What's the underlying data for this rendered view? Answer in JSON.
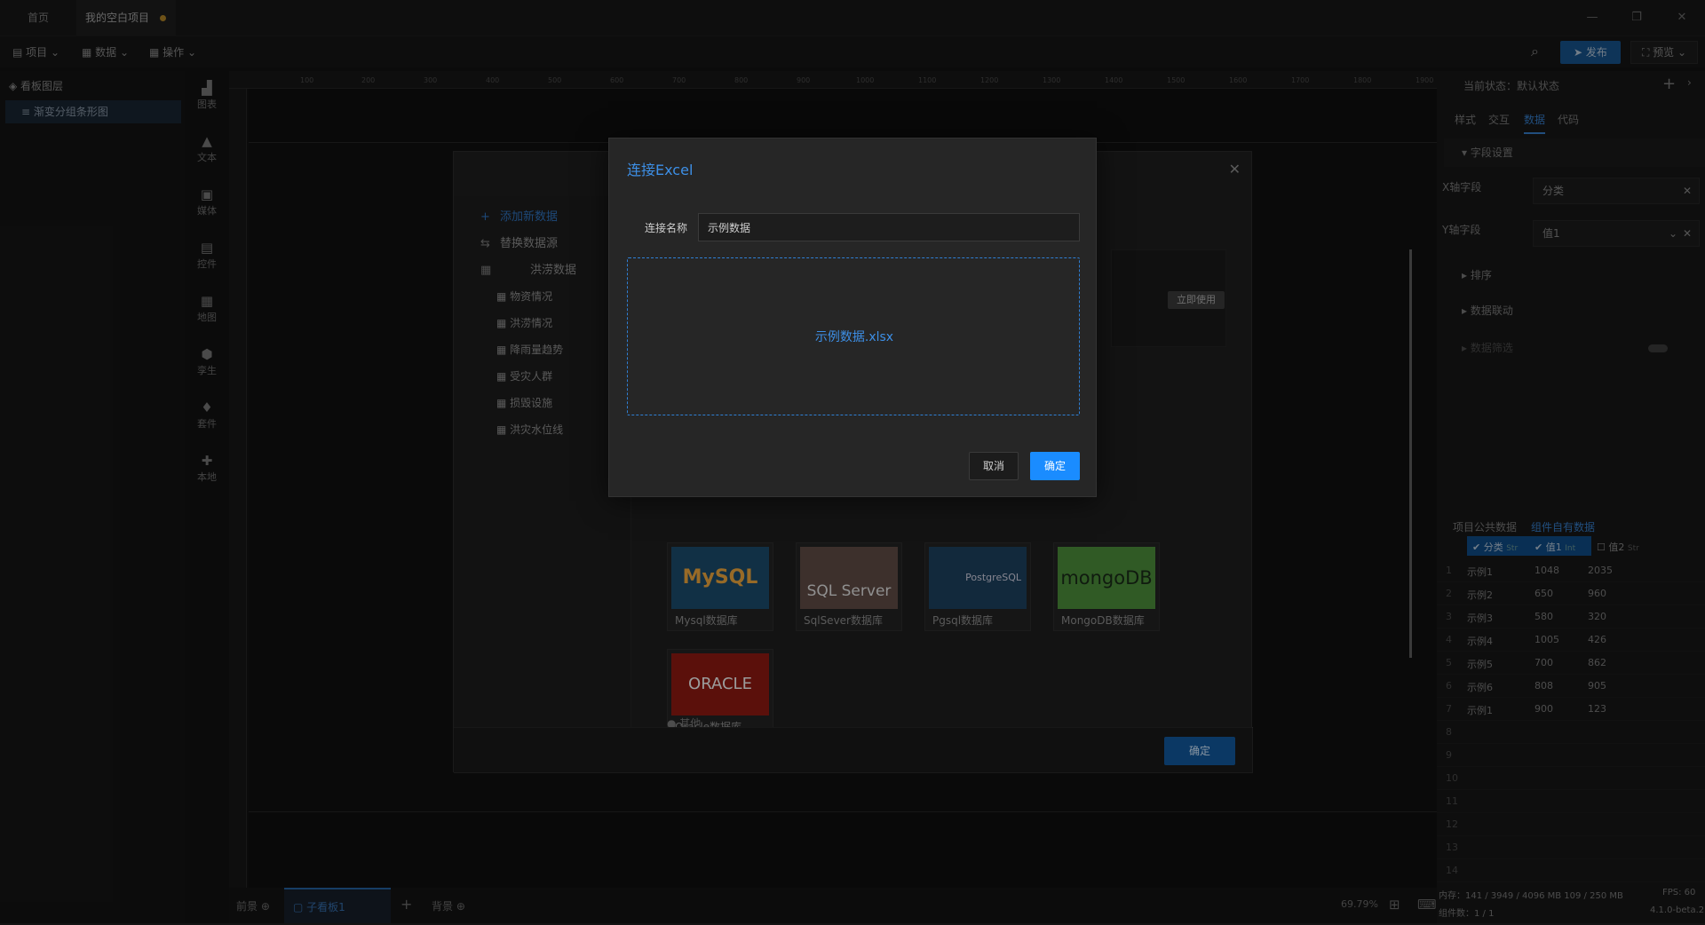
{
  "tabs": {
    "home": "首页",
    "project": "我的空白项目"
  },
  "toolbar": {
    "project": "项目",
    "data": "数据",
    "operate": "操作",
    "publish": "发布",
    "preview": "预览"
  },
  "layers": {
    "title": "看板图层",
    "item": "渐变分组条形图"
  },
  "iconbar": [
    "图表",
    "文本",
    "媒体",
    "控件",
    "地图",
    "孪生",
    "套件",
    "本地"
  ],
  "ruler": [
    "100",
    "200",
    "300",
    "400",
    "500",
    "600",
    "700",
    "800",
    "900",
    "1000",
    "1100",
    "1200",
    "1300",
    "1400",
    "1500",
    "1600",
    "1700",
    "1800",
    "1900"
  ],
  "bottom": {
    "front": "前景",
    "child": "子看板1",
    "back": "背景",
    "zoom": "69.79%"
  },
  "right": {
    "state_label": "当前状态：默认状态",
    "tabs": [
      "样式",
      "交互",
      "数据",
      "代码"
    ],
    "field_settings": "字段设置",
    "x_label": "X轴字段",
    "x_value": "分类",
    "y_label": "Y轴字段",
    "y_value": "值1",
    "sort": "排序",
    "link": "数据联动",
    "filter": "数据筛选",
    "data_tabs": [
      "项目公共数据",
      "组件自有数据"
    ],
    "columns": [
      "分类",
      "值1",
      "值2"
    ],
    "col_types": [
      "Str",
      "Int",
      "Str"
    ],
    "rows": [
      [
        "1",
        "示例1",
        "1048",
        "2035"
      ],
      [
        "2",
        "示例2",
        "650",
        "960"
      ],
      [
        "3",
        "示例3",
        "580",
        "320"
      ],
      [
        "4",
        "示例4",
        "1005",
        "426"
      ],
      [
        "5",
        "示例5",
        "700",
        "862"
      ],
      [
        "6",
        "示例6",
        "808",
        "905"
      ],
      [
        "7",
        "示例1",
        "900",
        "123"
      ],
      [
        "8",
        "",
        "",
        ""
      ],
      [
        "9",
        "",
        "",
        ""
      ],
      [
        "10",
        "",
        "",
        ""
      ],
      [
        "11",
        "",
        "",
        ""
      ],
      [
        "12",
        "",
        "",
        ""
      ],
      [
        "13",
        "",
        "",
        ""
      ],
      [
        "14",
        "",
        "",
        ""
      ]
    ],
    "memory": "内存：141 / 3949 / 4096 MB  109 / 250 MB",
    "fps": "FPS:  60",
    "components": "组件数：1 / 1",
    "version": "4.1.0-beta.2"
  },
  "datasource": {
    "nav_add": "添加新数据",
    "nav_replace": "替换数据源",
    "group": "洪涝数据",
    "items": [
      "物资情况",
      "洪涝情况",
      "降雨量趋势",
      "受灾人群",
      "损毁设施",
      "洪灾水位线"
    ],
    "use_now": "立即使用",
    "dbs": [
      "Mysql数据库",
      "SqlSever数据库",
      "Pgsql数据库",
      "MongoDB数据库",
      "Oracle数据库"
    ],
    "db_logos": [
      "MySQL",
      "SQL Server",
      "PostgreSQL",
      "mongoDB",
      "ORACLE"
    ],
    "other": "其他",
    "ok": "确定"
  },
  "excel": {
    "title": "连接Excel",
    "name_label": "连接名称",
    "name_value": "示例数据",
    "file": "示例数据.xlsx",
    "cancel": "取消",
    "ok": "确定"
  }
}
